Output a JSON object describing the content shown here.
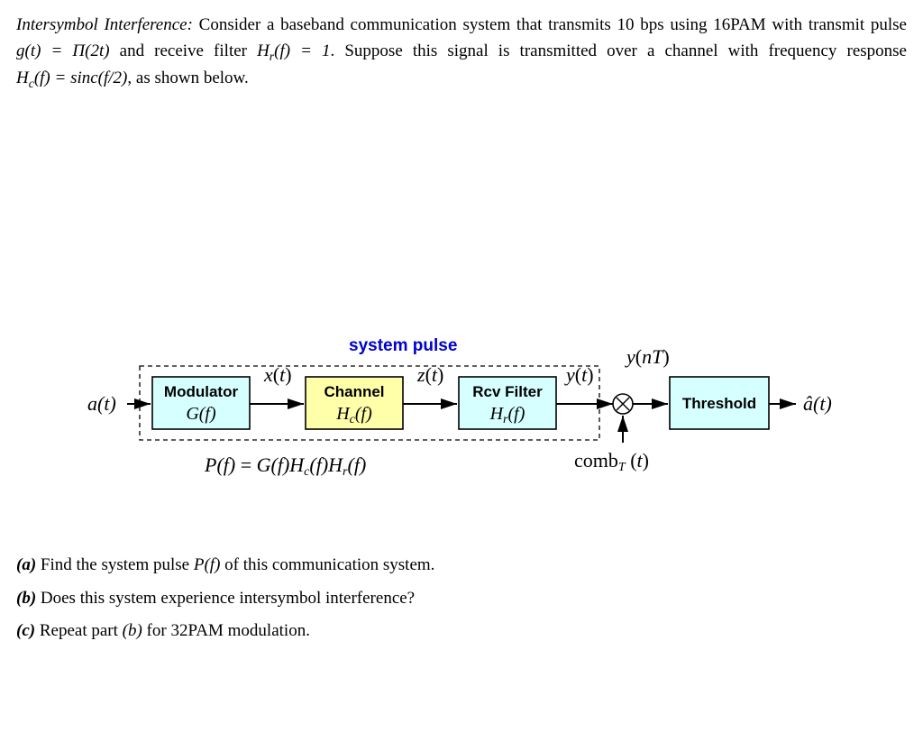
{
  "intro": {
    "title_prefix": "Intersymbol Interference:",
    "part1": " Consider a baseband communication system that transmits 10 bps using 16PAM with transmit pulse ",
    "eq_g": "g(t) = Π(2t)",
    "part2": " and receive filter ",
    "eq_hr": "H_r(f) = 1",
    "part3": ". Suppose this signal is transmitted over a channel with frequency response ",
    "eq_hc": "H_c(f) = sinc(f/2)",
    "part4": ", as shown below."
  },
  "diagram": {
    "system_pulse_label": "system pulse",
    "input": "a(t)",
    "modulator_top": "Modulator",
    "modulator_bottom": "G(f)",
    "sig_x": "x(t)",
    "channel_top": "Channel",
    "channel_bottom": "H_c(f)",
    "sig_z": "z(t)",
    "rcv_top": "Rcv Filter",
    "rcv_bottom": "H_r(f)",
    "sig_y": "y(t)",
    "sample": "y(nT)",
    "threshold": "Threshold",
    "output": "â(t)",
    "comb": "comb_T (t)",
    "pf_eq": "P(f) = G(f)H_c(f)H_r(f)"
  },
  "questions": {
    "a_label": "(a)",
    "a_text": "Find the system pulse P(f) of this communication system.",
    "b_label": "(b)",
    "b_text": "Does this system experience intersymbol interference?",
    "c_label": "(c)",
    "c_text_1": "Repeat part ",
    "c_text_ref": "(b)",
    "c_text_2": " for 32PAM modulation."
  }
}
